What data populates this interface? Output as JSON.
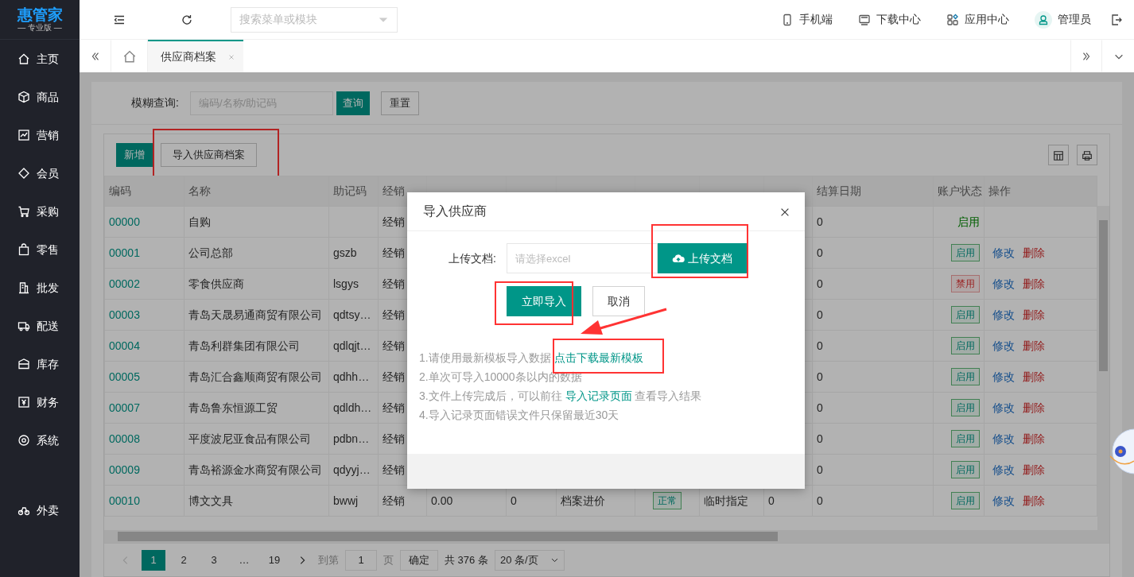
{
  "sidebar": {
    "logo": "惠管家",
    "edition": "— 专业版 —",
    "items": [
      {
        "label": "主页",
        "selected": false
      },
      {
        "label": "商品",
        "selected": false
      },
      {
        "label": "营销",
        "selected": false
      },
      {
        "label": "会员",
        "selected": false
      },
      {
        "label": "采购",
        "selected": false
      },
      {
        "label": "零售",
        "selected": false
      },
      {
        "label": "批发",
        "selected": false
      },
      {
        "label": "配送",
        "selected": false
      },
      {
        "label": "库存",
        "selected": false
      },
      {
        "label": "财务",
        "selected": false
      },
      {
        "label": "系统",
        "selected": false
      }
    ],
    "bottom_items": [
      {
        "label": "外卖",
        "selected": false
      }
    ]
  },
  "header": {
    "search": {
      "placeholder": "搜索菜单或模块"
    },
    "links": [
      "手机端",
      "下载中心",
      "应用中心"
    ],
    "user": "管理员"
  },
  "tabs": [
    {
      "label": "供应商档案",
      "selected": true
    }
  ],
  "filter": {
    "label": "模糊查询:",
    "placeholder": "编码/名称/助记码",
    "buttons": [
      "查询",
      "重置"
    ]
  },
  "toolbar": [
    {
      "label": "新增",
      "kind": "primary",
      "highlighted": false
    },
    {
      "label": "导入供应商档案",
      "kind": "default",
      "highlighted": true
    }
  ],
  "table": {
    "columns": [
      "编码",
      "名称",
      "助记码",
      "经销",
      "",
      "",
      "",
      "",
      "",
      "",
      "结算日期",
      "账户状态",
      "操作"
    ],
    "rows": [
      {
        "code": "00000",
        "name": "自购",
        "mnemonic": "",
        "type": "经销",
        "settle_date": "0",
        "status": {
          "label": "启用",
          "enabled": true,
          "tagged": false
        },
        "actions": []
      },
      {
        "code": "00001",
        "name": "公司总部",
        "mnemonic": "gszb",
        "type": "经销",
        "settle_date": "0",
        "status": {
          "label": "启用",
          "enabled": true,
          "tagged": true
        },
        "actions": [
          {
            "label": "修改",
            "kind": "edit"
          },
          {
            "label": "删除",
            "kind": "delete"
          }
        ]
      },
      {
        "code": "00002",
        "name": "零食供应商",
        "mnemonic": "lsgys",
        "type": "经销",
        "settle_date": "0",
        "status": {
          "label": "禁用",
          "enabled": false,
          "tagged": true
        },
        "actions": [
          {
            "label": "修改",
            "kind": "edit"
          },
          {
            "label": "删除",
            "kind": "delete"
          }
        ]
      },
      {
        "code": "00003",
        "name": "青岛天晟易通商贸有限公司",
        "mnemonic": "qdtsy…",
        "type": "经销",
        "settle_date": "0",
        "status": {
          "label": "启用",
          "enabled": true,
          "tagged": true
        },
        "actions": [
          {
            "label": "修改",
            "kind": "edit"
          },
          {
            "label": "删除",
            "kind": "delete"
          }
        ]
      },
      {
        "code": "00004",
        "name": "青岛利群集团有限公司",
        "mnemonic": "qdlqjt…",
        "type": "经销",
        "settle_date": "0",
        "status": {
          "label": "启用",
          "enabled": true,
          "tagged": true
        },
        "actions": [
          {
            "label": "修改",
            "kind": "edit"
          },
          {
            "label": "删除",
            "kind": "delete"
          }
        ]
      },
      {
        "code": "00005",
        "name": "青岛汇合鑫顺商贸有限公司",
        "mnemonic": "qdhh…",
        "type": "经销",
        "settle_date": "0",
        "status": {
          "label": "启用",
          "enabled": true,
          "tagged": true
        },
        "actions": [
          {
            "label": "修改",
            "kind": "edit"
          },
          {
            "label": "删除",
            "kind": "delete"
          }
        ]
      },
      {
        "code": "00007",
        "name": "青岛鲁东恒源工贸",
        "mnemonic": "qdldh…",
        "type": "经销",
        "settle_date": "0",
        "status": {
          "label": "启用",
          "enabled": true,
          "tagged": true
        },
        "actions": [
          {
            "label": "修改",
            "kind": "edit"
          },
          {
            "label": "删除",
            "kind": "delete"
          }
        ]
      },
      {
        "code": "00008",
        "name": "平度波尼亚食品有限公司",
        "mnemonic": "pdbn…",
        "type": "经销",
        "settle_date": "0",
        "status": {
          "label": "启用",
          "enabled": true,
          "tagged": true
        },
        "actions": [
          {
            "label": "修改",
            "kind": "edit"
          },
          {
            "label": "删除",
            "kind": "delete"
          }
        ]
      },
      {
        "code": "00009",
        "name": "青岛裕源金水商贸有限公司",
        "mnemonic": "qdyyj…",
        "type": "经销",
        "settle_date": "0",
        "status": {
          "label": "启用",
          "enabled": true,
          "tagged": true
        },
        "actions": [
          {
            "label": "修改",
            "kind": "edit"
          },
          {
            "label": "删除",
            "kind": "delete"
          }
        ]
      },
      {
        "code": "00010",
        "name": "博文文具",
        "mnemonic": "bwwj",
        "type": "经销",
        "column_5": "0.00",
        "column_6": "0",
        "column_7": "档案进价",
        "column_8": "正常",
        "column_9": "临时指定",
        "column_10": "0",
        "settle_date": "0",
        "status": {
          "label": "启用",
          "enabled": true,
          "tagged": true
        },
        "actions": [
          {
            "label": "修改",
            "kind": "edit"
          },
          {
            "label": "删除",
            "kind": "delete"
          }
        ]
      }
    ]
  },
  "pagination": {
    "pages": [
      {
        "label": "1",
        "selected": true
      },
      {
        "label": "2",
        "selected": false
      },
      {
        "label": "3",
        "selected": false
      },
      {
        "label": "…",
        "selected": false
      },
      {
        "label": "19",
        "selected": false
      }
    ],
    "goto_label": "到第",
    "goto_value": "1",
    "page_unit": "页",
    "confirm": "确定",
    "total": "共 376 条",
    "page_size": "20 条/页"
  },
  "modal": {
    "title": "导入供应商",
    "upload_label": "上传文档:",
    "upload_placeholder": "请选择excel",
    "upload_button": {
      "label": "上传文档",
      "highlighted": true
    },
    "buttons": [
      {
        "label": "立即导入",
        "kind": "primary",
        "highlighted": true
      },
      {
        "label": "取消",
        "kind": "default",
        "highlighted": false
      }
    ],
    "annotation_arrow": true,
    "notes": [
      {
        "before": "1.请使用最新模板导入数据 ",
        "link": "点击下载最新模板",
        "link_highlighted": true
      },
      {
        "before": "2.单次可导入10000条以内的数据"
      },
      {
        "before": "3.文件上传完成后，可以前往 ",
        "link": "导入记录页面",
        "after": " 查看导入结果"
      },
      {
        "before": "4.导入记录页面错误文件只保留最近30天"
      }
    ]
  }
}
